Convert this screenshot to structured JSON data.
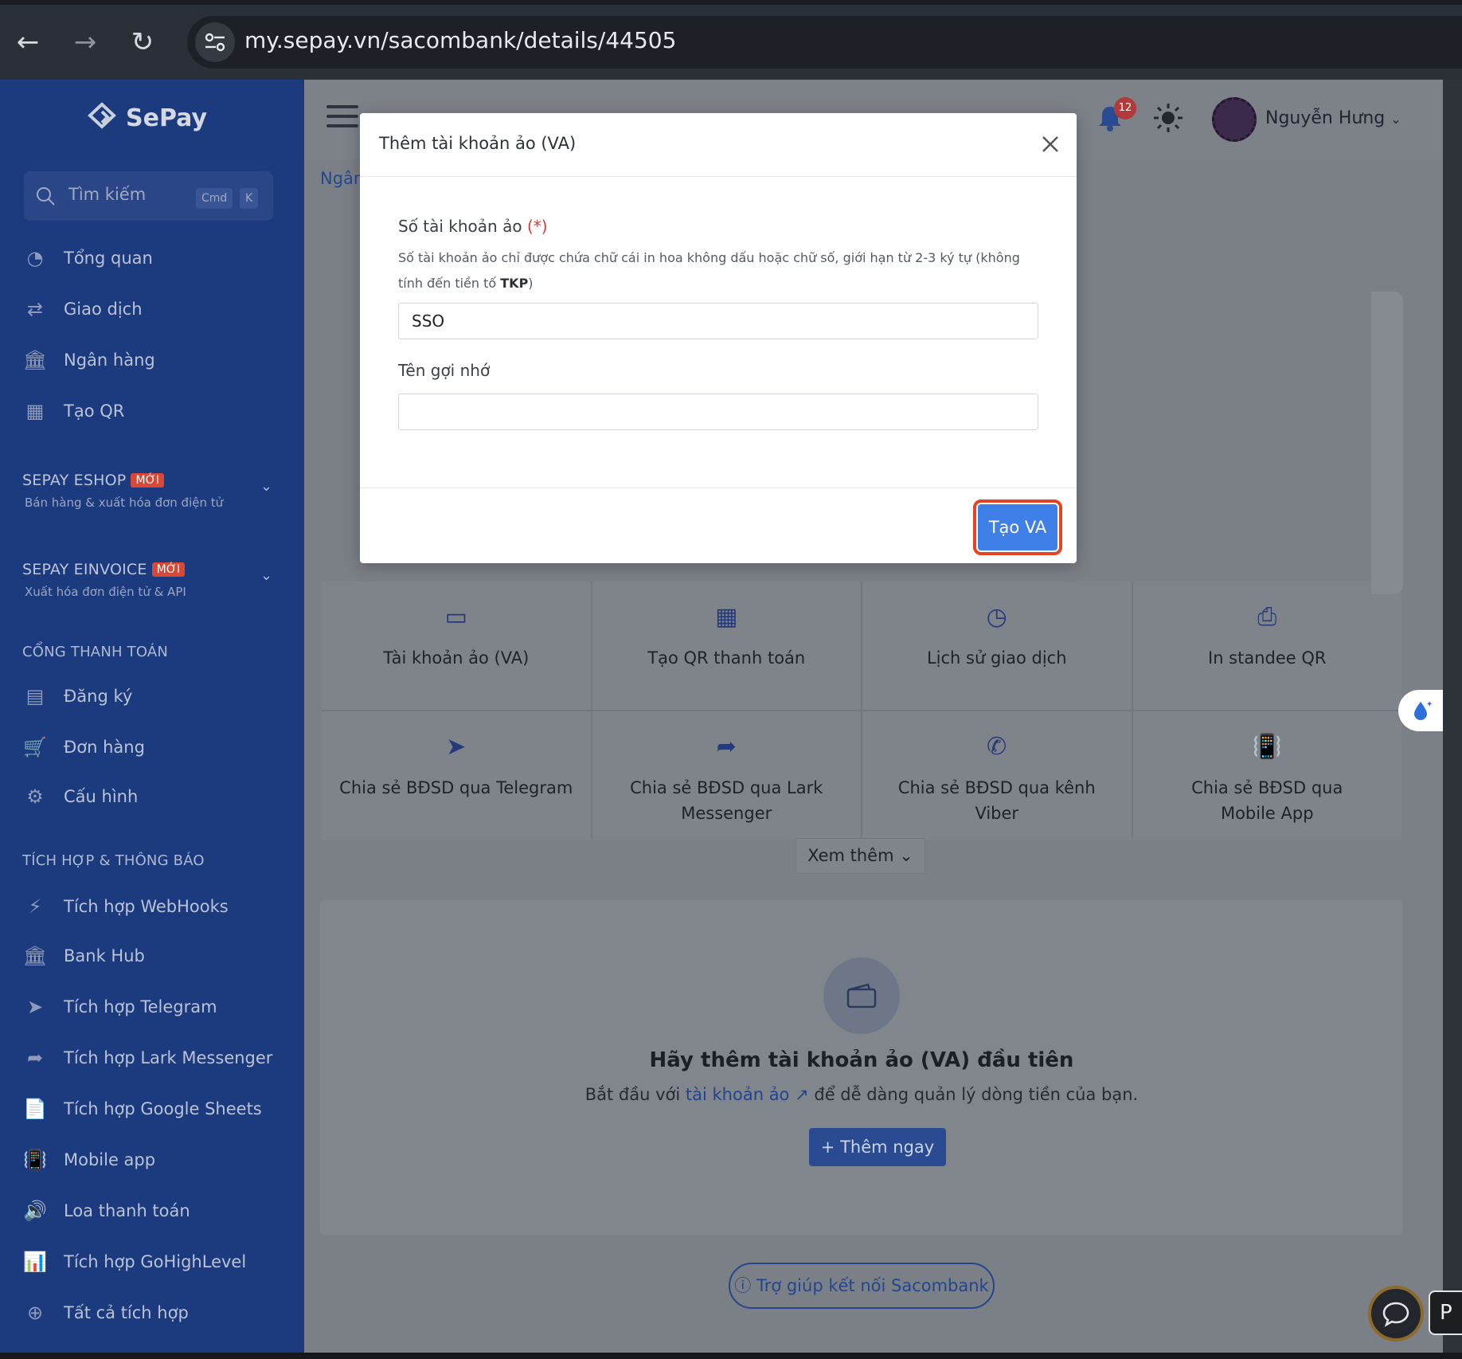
{
  "browser": {
    "url": "my.sepay.vn/sacombank/details/44505"
  },
  "sidebar": {
    "brand": "SePay",
    "search": {
      "placeholder": "Tìm kiếm",
      "kbd1": "Cmd",
      "kbd2": "K"
    },
    "main_items": [
      {
        "label": "Tổng quan",
        "icon": "dashboard-icon"
      },
      {
        "label": "Giao dịch",
        "icon": "transfer-icon"
      },
      {
        "label": "Ngân hàng",
        "icon": "bank-icon"
      },
      {
        "label": "Tạo QR",
        "icon": "qr-icon"
      }
    ],
    "eshop": {
      "title": "SEPAY ESHOP",
      "badge": "MỚI",
      "subtitle": "Bán hàng & xuất hóa đơn điện tử"
    },
    "einvoice": {
      "title": "SEPAY EINVOICE",
      "badge": "MỚI",
      "subtitle": "Xuất hóa đơn điện tử & API"
    },
    "payment_section": "CỔNG THANH TOÁN",
    "payment_items": [
      {
        "label": "Đăng ký",
        "icon": "register-icon"
      },
      {
        "label": "Đơn hàng",
        "icon": "cart-icon"
      },
      {
        "label": "Cấu hình",
        "icon": "gear-icon"
      }
    ],
    "integration_section": "TÍCH HỢP & THÔNG BÁO",
    "integration_items": [
      {
        "label": "Tích hợp WebHooks",
        "icon": "lightning-icon"
      },
      {
        "label": "Bank Hub",
        "icon": "bank-icon"
      },
      {
        "label": "Tích hợp Telegram",
        "icon": "telegram-icon"
      },
      {
        "label": "Tích hợp Lark Messenger",
        "icon": "send-icon"
      },
      {
        "label": "Tích hợp Google Sheets",
        "icon": "sheet-icon"
      },
      {
        "label": "Mobile app",
        "icon": "phone-vibrate-icon"
      },
      {
        "label": "Loa thanh toán",
        "icon": "speaker-icon"
      },
      {
        "label": "Tích hợp GoHighLevel",
        "icon": "chart-icon"
      },
      {
        "label": "Tất cả tích hợp",
        "icon": "plus-circle-icon"
      }
    ]
  },
  "header": {
    "notifications": "12",
    "user_name": "Nguyễn Hưng"
  },
  "breadcrumb": "Ngân",
  "feature_cards": [
    {
      "label": "Tài khoản ảo (VA)",
      "icon": "card-icon"
    },
    {
      "label": "Tạo QR thanh toán",
      "icon": "qr-icon"
    },
    {
      "label": "Lịch sử giao dịch",
      "icon": "clock-icon"
    },
    {
      "label": "In standee QR",
      "icon": "printer-icon"
    },
    {
      "label": "Chia sẻ BĐSD qua Telegram",
      "icon": "telegram-icon"
    },
    {
      "label": "Chia sẻ BĐSD qua Lark Messenger",
      "icon": "send-icon"
    },
    {
      "label": "Chia sẻ BĐSD qua kênh Viber",
      "icon": "viber-icon"
    },
    {
      "label": "Chia sẻ BĐSD qua Mobile App",
      "icon": "phone-vibrate-icon"
    }
  ],
  "see_more": "Xem thêm",
  "empty_state": {
    "title": "Hãy thêm tài khoản ảo (VA) đầu tiên",
    "desc_before": "Bắt đầu với ",
    "desc_link": "tài khoản ảo",
    "desc_after": " để dễ dàng quản lý dòng tiền của bạn.",
    "button": "+ Thêm ngay"
  },
  "help_button": "Trợ giúp kết nối Sacombank",
  "chip_text": "P",
  "modal": {
    "title": "Thêm tài khoản ảo (VA)",
    "va_label": "Số tài khoản ảo",
    "required_mark": "(*)",
    "hint_text": "Số tài khoản ảo chỉ được chứa chữ cái in hoa không dấu hoặc chữ số, giới hạn từ 2-3 ký tự (không tính đến tiền tố ",
    "hint_bold": "TKP",
    "hint_end": ")",
    "va_value": "SSO",
    "name_label": "Tên gợi nhớ",
    "name_value": "",
    "create_button": "Tạo VA"
  }
}
